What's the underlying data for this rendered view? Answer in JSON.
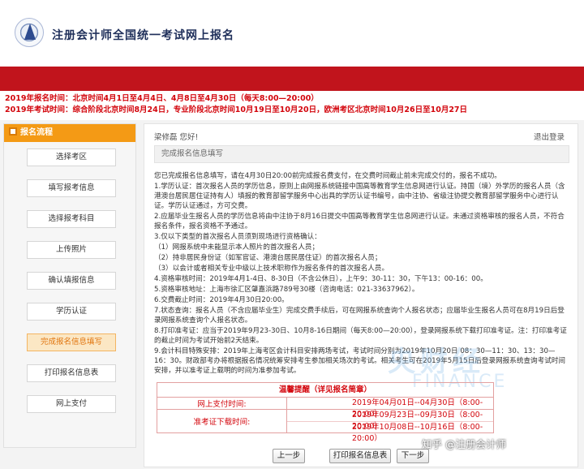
{
  "header": {
    "site_title": "注册会计师全国统一考试网上报名"
  },
  "notice": {
    "line1": "2019年报名时间：北京时间4月1日至4月4日、4月8日至4月30日（每天8:00—20:00）",
    "line2": "2019年考试时间：综合阶段北京时间8月24日，专业阶段北京时间10月19日至10月20日，欧洲考区北京时间10月26日至10月27日"
  },
  "sidebar": {
    "title": "报名流程",
    "items": [
      {
        "label": "选择考区"
      },
      {
        "label": "填写报考信息"
      },
      {
        "label": "选择报考科目"
      },
      {
        "label": "上传照片"
      },
      {
        "label": "确认填报信息"
      },
      {
        "label": "学历认证"
      },
      {
        "label": "完成报名信息填写"
      },
      {
        "label": "打印报名信息表"
      },
      {
        "label": "网上支付"
      }
    ],
    "active_index": 6
  },
  "main": {
    "greeting": "梁修磊 您好!",
    "logout": "退出登录",
    "section_title": "完成报名信息填写",
    "paragraphs": [
      "您已完成报名信息填写，请在4月30日20:00前完成报名费支付，在交费时间截止前未完成交付的，报名不成功。",
      "1.学历认证：首次报名人员的学历信息，原则上由网报系统链接中国高等教育学生信息网进行认证。持国（境）外学历的报名人员（含港澳台居民居住证持有人）填报的教育部留学服务中心出具的学历认证书编号，由中注协、省级注协提交教育部留学服务中心进行认证。学历认证通过，方可交费。",
      "2.应届毕业生报名人员的学历信息将由中注协于8月16日提交中国高等教育学生信息网进行认证。未通过资格审核的报名人员，不符合报名条件，报名资格不予通过。",
      "3.仅以下类型的首次报名人员须到现场进行资格确认：",
      "（1）网报系统中未能显示本人照片的首次报名人员；",
      "（2）持非居民身份证（如军官证、港澳台居民居住证）的首次报名人员；",
      "（3）以会计或者相关专业中级以上技术职称作为报名条件的首次报名人员。",
      "4.资格审核时间：2019年4月1-4日、8-30日（不含公休日），上午9：30-11：30，下午13：00-16：00。",
      "5.资格审核地址：上海市徐汇区肇嘉浜路789号30楼（咨询电话：021-33637962）。",
      "6.交费截止时间：2019年4月30日20:00。",
      "7.状态查询：报名人员（不含应届毕业生）完成交费手续后，可在网报系统查询个人报名状态；应届毕业生报名人员可在8月19日后登录网报系统查询个人报名状态。",
      "8.打印准考证：应当于2019年9月23-30日、10月8-16日期间（每天8:00—20:00），登录网报系统下载打印准考证。注：打印准考证的截止时间为考试开始前2天结束。",
      "9.会计科目特殊安排：2019年上海考区会计科目安排两场考试，考试时间分别为2019年10月20日 08：30—11：30、13：30—16：30。财政部考办将根据报名情况统筹安排考生参加相关场次的考试。相关考生可在2019年5月15日后登录网报系统查询考试时间安排，并以准考证上载明的时间为准参加考试。"
    ],
    "watermark": "央财经",
    "watermark_sub": "FINANCE",
    "tip": {
      "title": "温馨提醒（详见报名简章）",
      "rows": [
        {
          "label": "网上支付时间:",
          "values": [
            "2019年04月01日--04月30日（8:00-20:00）"
          ]
        },
        {
          "label": "准考证下载时间:",
          "values": [
            "2019年09月23日--09月30日（8:00-20:00）",
            "2019年10月08日--10月16日（8:00-20:00）"
          ]
        }
      ]
    },
    "buttons": {
      "prev": "上一步",
      "print": "打印报名信息表",
      "next": "下一步"
    }
  },
  "overlay": {
    "source_mark": "知乎 @注册会计师"
  }
}
